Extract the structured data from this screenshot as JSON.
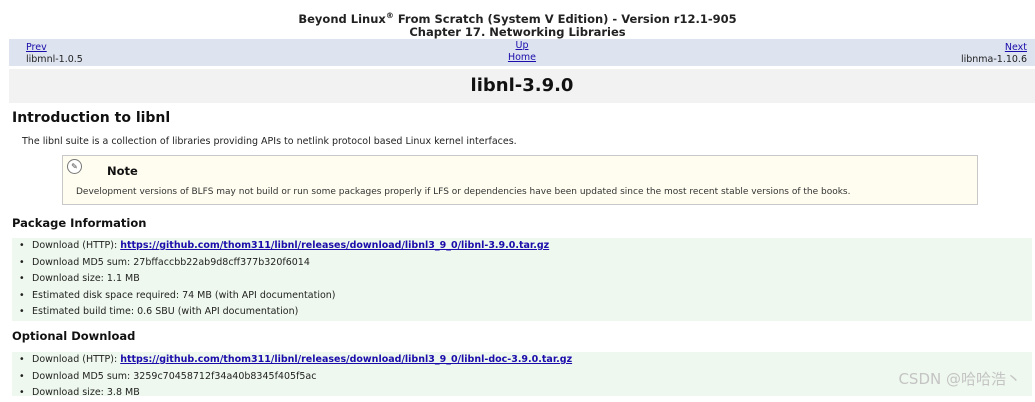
{
  "header": {
    "line1_before_sup": "Beyond Linux",
    "line1_sup": "®",
    "line1_after_sup": " From Scratch (System V Edition) - Version r12.1-905",
    "line2": "Chapter 17. Networking Libraries"
  },
  "nav": {
    "prev_label": "Prev",
    "prev_title": "libmnl-1.0.5",
    "up_label": "Up",
    "home_label": "Home",
    "next_label": "Next",
    "next_title": "libnma-1.10.6"
  },
  "page_title": "libnl-3.9.0",
  "intro": {
    "heading": "Introduction to libnl",
    "text": "The libnl suite is a collection of libraries providing APIs to netlink protocol based Linux kernel interfaces."
  },
  "note": {
    "icon": "note-icon",
    "title": "Note",
    "text": "Development versions of BLFS may not build or run some packages properly if LFS or dependencies have been updated since the most recent stable versions of the books."
  },
  "package_info": {
    "heading": "Package Information",
    "download_label": "Download (HTTP): ",
    "download_url": "https://github.com/thom311/libnl/releases/download/libnl3_9_0/libnl-3.9.0.tar.gz",
    "md5": "Download MD5 sum: 27bffaccbb22ab9d8cff377b320f6014",
    "size": "Download size: 1.1 MB",
    "disk": "Estimated disk space required: 74 MB (with API documentation)",
    "build_time": "Estimated build time: 0.6 SBU (with API documentation)"
  },
  "optional": {
    "heading": "Optional Download",
    "download_label": "Download (HTTP): ",
    "download_url": "https://github.com/thom311/libnl/releases/download/libnl3_9_0/libnl-doc-3.9.0.tar.gz",
    "md5": "Download MD5 sum: 3259c70458712f34a40b8345f405f5ac",
    "size": "Download size: 3.8 MB"
  },
  "watermark": "CSDN @哈哈浩丶"
}
